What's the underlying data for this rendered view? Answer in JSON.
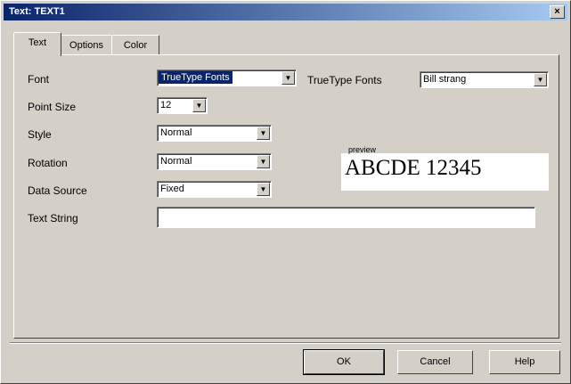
{
  "window": {
    "title": "Text: TEXT1"
  },
  "tabs": [
    {
      "label": "Text"
    },
    {
      "label": "Options"
    },
    {
      "label": "Color"
    }
  ],
  "form": {
    "font": {
      "label": "Font",
      "value": "TrueType Fonts"
    },
    "truetype_font": {
      "label": "TrueType Fonts",
      "value": "Bill strang"
    },
    "point_size": {
      "label": "Point Size",
      "value": "12"
    },
    "style": {
      "label": "Style",
      "value": "Normal"
    },
    "rotation": {
      "label": "Rotation",
      "value": "Normal"
    },
    "data_source": {
      "label": "Data Source",
      "value": "Fixed"
    },
    "text_string": {
      "label": "Text String",
      "value": ""
    }
  },
  "preview": {
    "caption": "preview",
    "sample": "ABCDE 12345"
  },
  "buttons": {
    "ok": "OK",
    "cancel": "Cancel",
    "help": "Help"
  },
  "icons": {
    "close": "close-icon",
    "dropdown": "chevron-down-icon"
  },
  "colors": {
    "titlebar_start": "#0a246a",
    "titlebar_end": "#a6caf0",
    "face": "#d4d0c8",
    "selection": "#0a246a"
  }
}
